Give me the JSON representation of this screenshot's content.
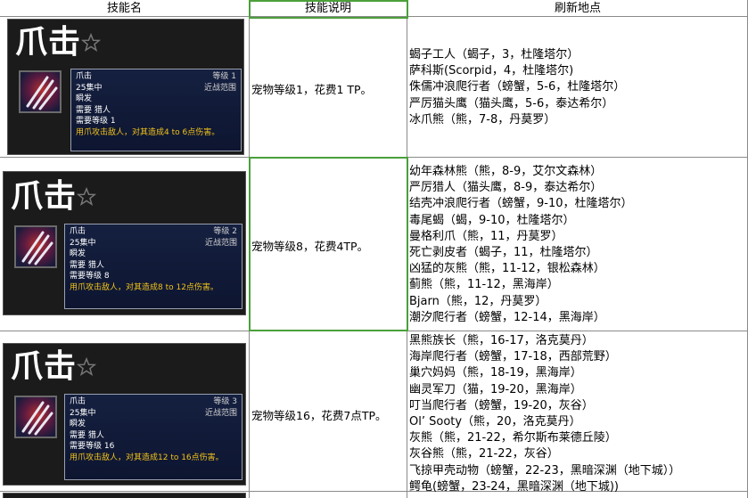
{
  "headers": {
    "skill_name": "技能名",
    "skill_desc": "技能说明",
    "refresh_location": "刷新地点"
  },
  "rows": [
    {
      "card": {
        "big_name": "爪击",
        "name": "爪击",
        "level": "等级 1",
        "cost": "25集中",
        "range": "近战范围",
        "cast": "瞬发",
        "requires": "需要 猎人",
        "req_level": "需要等级 1",
        "effect": "用爪攻击敌人，对其造成4 to 6点伤害。"
      },
      "description": "宠物等级1，花费1 TP。",
      "locations": [
        "蝎子工人（蝎子，3，杜隆塔尔）",
        "萨科斯(Scorpid，4，杜隆塔尔)",
        "侏儒冲浪爬行者（螃蟹，5-6，杜隆塔尔）",
        "严厉猫头鹰（猫头鹰，5-6，泰达希尔）",
        "冰爪熊（熊，7-8，丹莫罗）"
      ]
    },
    {
      "card": {
        "big_name": "爪击",
        "name": "爪击",
        "level": "等级 2",
        "cost": "25集中",
        "range": "近战范围",
        "cast": "瞬发",
        "requires": "需要 猎人",
        "req_level": "需要等级 8",
        "effect": "用爪攻击敌人，对其造成8 to 12点伤害。"
      },
      "description": "宠物等级8，花费4TP。",
      "locations": [
        "幼年森林熊（熊，8-9，艾尔文森林）",
        "严厉猎人（猫头鹰，8-9，泰达希尔）",
        "结壳冲浪爬行者（螃蟹，9-10，杜隆塔尔）",
        "毒尾蝎（蝎，9-10，杜隆塔尔）",
        "曼格利爪（熊，11，丹莫罗）",
        "死亡剥皮者（蝎子，11，杜隆塔尔）",
        "凶猛的灰熊（熊，11-12，银松森林）",
        "蓟熊（熊，11-12，黑海岸）",
        "Bjarn（熊，12，丹莫罗）",
        "潮汐爬行者（螃蟹，12-14，黑海岸）"
      ]
    },
    {
      "card": {
        "big_name": "爪击",
        "name": "爪击",
        "level": "等级 3",
        "cost": "25集中",
        "range": "近战范围",
        "cast": "瞬发",
        "requires": "需要 猎人",
        "req_level": "需要等级 16",
        "effect": "用爪攻击敌人，对其造成12 to 16点伤害。"
      },
      "description": "宠物等级16，花费7点TP。",
      "locations": [
        "黑熊族长（熊，16-17，洛克莫丹）",
        "海岸爬行者（螃蟹，17-18，西部荒野）",
        "巢穴妈妈（熊，18-19，黑海岸）",
        "幽灵军刀（猫，19-20，黑海岸）",
        "叮当爬行者（螃蟹，19-20，灰谷）",
        "Ol’ Sooty（熊，20，洛克莫丹）",
        "灰熊（熊，21-22，希尔斯布莱德丘陵）",
        "灰谷熊（熊，21-22，灰谷）",
        "飞掠甲壳动物（螃蟹，22-23，黑暗深渊（地下城））",
        "鳄龟(螃蟹，23-24，黑暗深渊（地下城))"
      ]
    }
  ]
}
